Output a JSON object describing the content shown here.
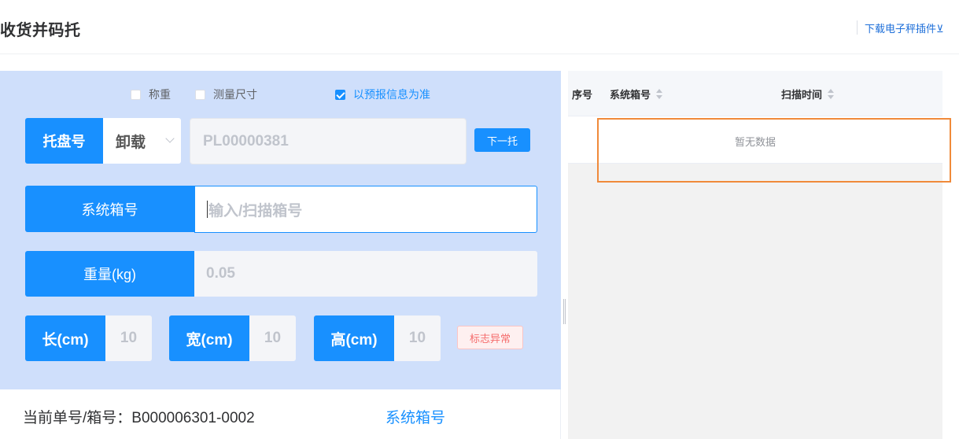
{
  "header": {
    "title": "收货并码托",
    "download_link": "下载电子秤插件⊻"
  },
  "options": {
    "weigh": {
      "label": "称重",
      "checked": false
    },
    "measure": {
      "label": "测量尺寸",
      "checked": false
    },
    "use_prealert": {
      "label": "以预报信息为准",
      "checked": true
    }
  },
  "pallet": {
    "label": "托盘号",
    "mode": "卸载",
    "value": "PL00000381",
    "next_button": "下一托"
  },
  "box": {
    "label": "系统箱号",
    "placeholder": "输入/扫描箱号"
  },
  "weight": {
    "label": "重量(kg)",
    "value": "0.05"
  },
  "dimensions": {
    "length": {
      "label": "长(cm)",
      "value": "10"
    },
    "width": {
      "label": "宽(cm)",
      "value": "10"
    },
    "height": {
      "label": "高(cm)",
      "value": "10"
    }
  },
  "abnormal_button": "标志异常",
  "current": {
    "order_box": "当前单号/箱号：B000006301-0002",
    "box_label": "系统箱号"
  },
  "table": {
    "columns": [
      "序号",
      "系统箱号",
      "扫描时间"
    ],
    "empty_text": "暂无数据"
  },
  "colors": {
    "primary": "#1890ff",
    "panel_bg": "#cfdffb",
    "highlight": "#f08a3a",
    "danger": "#f56c6c"
  }
}
